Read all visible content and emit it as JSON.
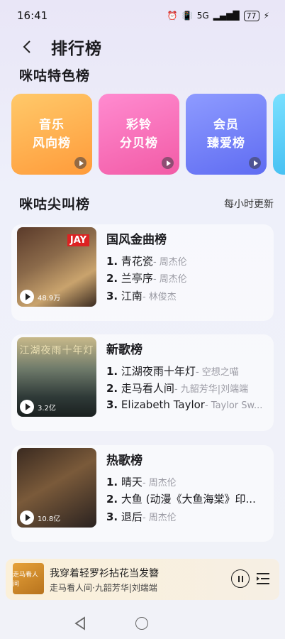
{
  "status": {
    "time": "16:41",
    "network": "5G",
    "battery": "77"
  },
  "header": {
    "title": "排行榜"
  },
  "featured": {
    "title": "咪咕特色榜",
    "cards": [
      {
        "line1": "音乐",
        "line2": "风向榜"
      },
      {
        "line1": "彩铃",
        "line2": "分贝榜"
      },
      {
        "line1": "会员",
        "line2": "臻爱榜"
      }
    ]
  },
  "hot": {
    "title": "咪咕尖叫榜",
    "update_note": "每小时更新",
    "charts": [
      {
        "name": "国风金曲榜",
        "plays": "48.9万",
        "cover_tag": "JAY",
        "tracks": [
          {
            "rank": "1.",
            "song": "青花瓷",
            "artist": "- 周杰伦"
          },
          {
            "rank": "2.",
            "song": "兰亭序",
            "artist": "- 周杰伦"
          },
          {
            "rank": "3.",
            "song": "江南",
            "artist": "- 林俊杰"
          }
        ]
      },
      {
        "name": "新歌榜",
        "plays": "3.2亿",
        "cover_caption": "江湖夜雨十年灯",
        "tracks": [
          {
            "rank": "1.",
            "song": "江湖夜雨十年灯",
            "artist": "- 空想之喵"
          },
          {
            "rank": "2.",
            "song": "走马看人间",
            "artist": "- 九韶芳华|刘端端"
          },
          {
            "rank": "3.",
            "song": "Elizabeth Taylor",
            "artist": "- Taylor Sw..."
          }
        ]
      },
      {
        "name": "热歌榜",
        "plays": "10.8亿",
        "tracks": [
          {
            "rank": "1.",
            "song": "晴天",
            "artist": "- 周杰伦"
          },
          {
            "rank": "2.",
            "song": "大鱼 (动漫《大鱼海棠》印...",
            "artist": ""
          },
          {
            "rank": "3.",
            "song": "退后",
            "artist": "- 周杰伦"
          }
        ]
      }
    ]
  },
  "player": {
    "title": "我穿着轻罗衫拈花当发簪",
    "subtitle": "走马看人间·九韶芳华|刘端端",
    "cover_text": "走马看人间"
  }
}
